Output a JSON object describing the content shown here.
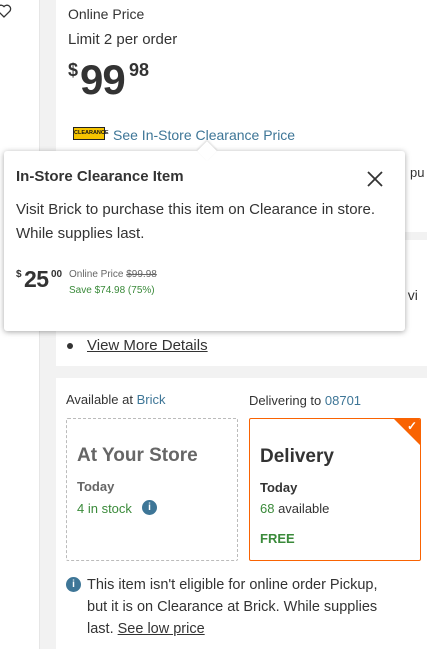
{
  "header": {
    "online_price_label": "Online Price",
    "limit_text": "Limit 2 per order",
    "price": {
      "currency": "$",
      "dollars": "99",
      "cents": "98"
    }
  },
  "clearance": {
    "badge_text": "CLEARANCE",
    "link_text": "See In-Store Clearance Price"
  },
  "background_fragments": {
    "line1": "pu",
    "line2": "f vi"
  },
  "tooltip": {
    "title": "In-Store Clearance Item",
    "body": "Visit Brick to purchase this item on Clearance in store. While supplies last.",
    "price": {
      "currency": "$",
      "dollars": "25",
      "cents": "00"
    },
    "online_price_label": "Online Price",
    "online_price_value": "$99.98",
    "save_text": "Save $74.98 (75%)"
  },
  "details": {
    "view_more": "View More Details"
  },
  "fulfillment": {
    "available_prefix": "Available at",
    "store_name": "Brick",
    "delivering_prefix": "Delivering to",
    "zip": "08701",
    "store_card": {
      "title": "At Your Store",
      "day": "Today",
      "stock": "4 in stock"
    },
    "delivery_card": {
      "title": "Delivery",
      "day": "Today",
      "count": "68",
      "available_word": " available",
      "shipping": "FREE"
    }
  },
  "notice": {
    "line1": "This item isn't eligible for online order Pickup,",
    "line2": "but it is on Clearance at Brick. While supplies",
    "line3_prefix": "last. ",
    "line3_link": "See low price"
  },
  "colors": {
    "accent_orange": "#f96302",
    "link_blue": "#3e7697",
    "success_green": "#3a8a3a",
    "badge_yellow": "#f5c400"
  },
  "icons": {
    "wishlist": "heart-icon",
    "close": "close-icon",
    "info": "info-icon",
    "selected": "checkmark-icon"
  }
}
